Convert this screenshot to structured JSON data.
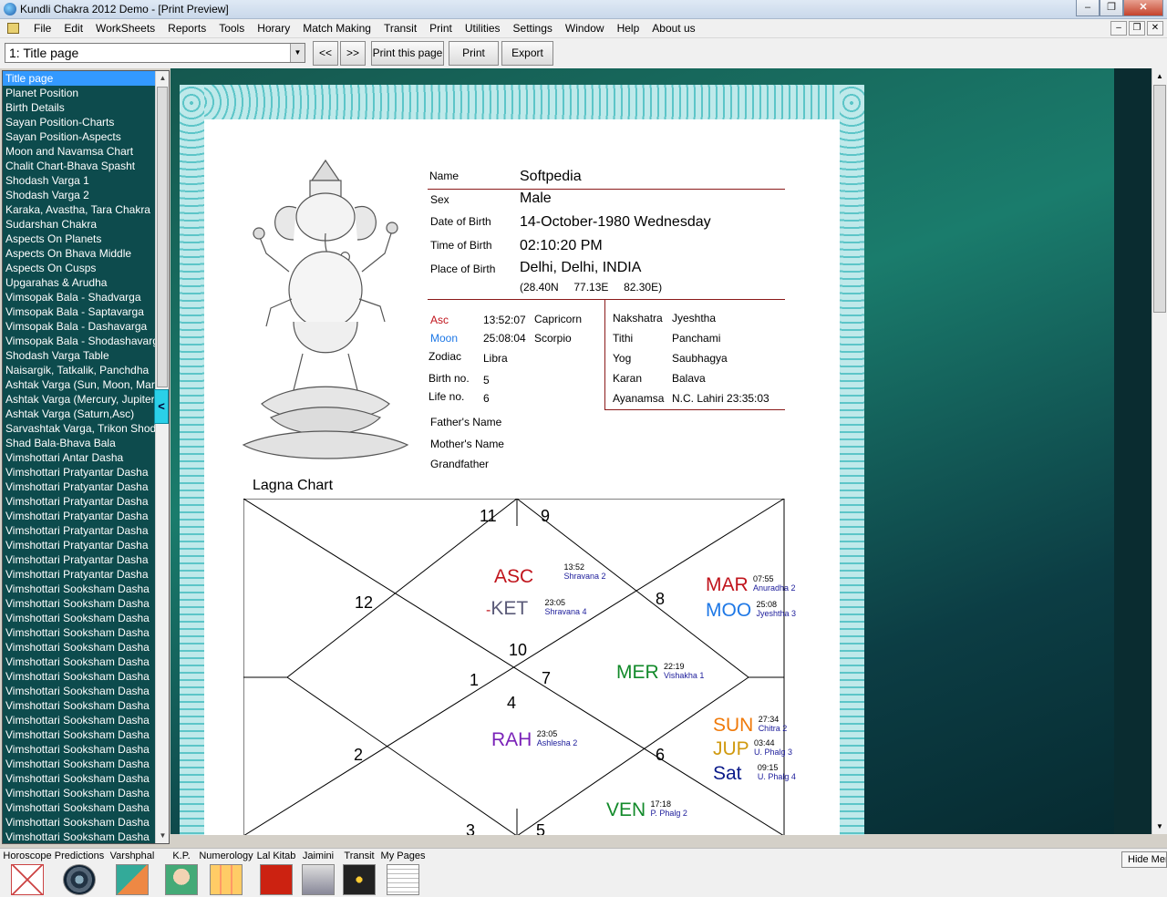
{
  "window": {
    "title": "Kundli Chakra 2012 Demo - [Print Preview]"
  },
  "menu": [
    "File",
    "Edit",
    "WorkSheets",
    "Reports",
    "Tools",
    "Horary",
    "Match Making",
    "Transit",
    "Print",
    "Utilities",
    "Settings",
    "Window",
    "Help",
    "About us"
  ],
  "toolbar": {
    "page_select": "1: Title page",
    "prev_label": "<<",
    "next_label": ">>",
    "print_page_label": "Print this page",
    "print_label": "Print",
    "export_label": "Export"
  },
  "sidebar": {
    "selected_index": 0,
    "items": [
      "Title page",
      "Planet Position",
      "Birth Details",
      "Sayan Position-Charts",
      "Sayan Position-Aspects",
      "Moon and Navamsa Chart",
      "Chalit Chart-Bhava Spasht",
      "Shodash Varga 1",
      "Shodash Varga 2",
      "Karaka, Avastha, Tara Chakra",
      "Sudarshan Chakra",
      "Aspects On Planets",
      "Aspects On Bhava Middle",
      "Aspects On Cusps",
      "Upgarahas & Arudha",
      "Vimsopak Bala - Shadvarga",
      "Vimsopak Bala - Saptavarga",
      "Vimsopak Bala - Dashavarga",
      "Vimsopak Bala - Shodashavarga",
      "Shodash Varga Table",
      "Naisargik, Tatkalik, Panchdha",
      "Ashtak Varga (Sun, Moon, Mars)",
      "Ashtak Varga (Mercury, Jupiter)",
      "Ashtak Varga (Saturn,Asc)",
      "Sarvashtak Varga, Trikon Shodhan",
      "Shad Bala-Bhava Bala",
      "Vimshottari Antar Dasha",
      "Vimshottari Pratyantar Dasha",
      "Vimshottari Pratyantar Dasha",
      "Vimshottari Pratyantar Dasha",
      "Vimshottari Pratyantar Dasha",
      "Vimshottari Pratyantar Dasha",
      "Vimshottari Pratyantar Dasha",
      "Vimshottari Pratyantar Dasha",
      "Vimshottari Pratyantar Dasha",
      "Vimshottari Sooksham Dasha",
      "Vimshottari Sooksham Dasha",
      "Vimshottari Sooksham Dasha",
      "Vimshottari Sooksham Dasha",
      "Vimshottari Sooksham Dasha",
      "Vimshottari Sooksham Dasha",
      "Vimshottari Sooksham Dasha",
      "Vimshottari Sooksham Dasha",
      "Vimshottari Sooksham Dasha",
      "Vimshottari Sooksham Dasha",
      "Vimshottari Sooksham Dasha",
      "Vimshottari Sooksham Dasha",
      "Vimshottari Sooksham Dasha",
      "Vimshottari Sooksham Dasha",
      "Vimshottari Sooksham Dasha",
      "Vimshottari Sooksham Dasha",
      "Vimshottari Sooksham Dasha",
      "Vimshottari Sooksham Dasha"
    ],
    "collapse_label": "<"
  },
  "details": {
    "name_label": "Name",
    "name": "Softpedia",
    "sex_label": "Sex",
    "sex": "Male",
    "dob_label": "Date of Birth",
    "dob": "14-October-1980 Wednesday",
    "tob_label": "Time of Birth",
    "tob": "02:10:20 PM",
    "pob_label": "Place of Birth",
    "pob": "Delhi, Delhi, INDIA",
    "coords": "(28.40N     77.13E     82.30E)",
    "asc_label": "Asc",
    "asc_time": "13:52:07",
    "asc_sign": "Capricorn",
    "moon_label": "Moon",
    "moon_time": "25:08:04",
    "moon_sign": "Scorpio",
    "zodiac_label": "Zodiac",
    "zodiac": "Libra",
    "birthno_label": "Birth no.",
    "birthno": "5",
    "lifeno_label": "Life no.",
    "lifeno": "6",
    "nakshatra_label": "Nakshatra",
    "nakshatra": "Jyeshtha",
    "tithi_label": "Tithi",
    "tithi": "Panchami",
    "yog_label": "Yog",
    "yog": "Saubhagya",
    "karan_label": "Karan",
    "karan": "Balava",
    "ayanamsa_label": "Ayanamsa",
    "ayanamsa": "N.C. Lahiri 23:35:03",
    "father_label": "Father's Name",
    "mother_label": "Mother's Name",
    "grandfather_label": "Grandfather"
  },
  "lagna_chart": {
    "title": "Lagna Chart",
    "houses": {
      "h11": "11",
      "h9": "9",
      "h12": "12",
      "h8": "8",
      "h10": "10",
      "h1": "1",
      "h7": "7",
      "h4": "4",
      "h2": "2",
      "h6": "6",
      "h3": "3",
      "h5": "5"
    },
    "planets": {
      "asc": {
        "abbr": "ASC",
        "time": "13:52",
        "nak": "Shravana 2",
        "color": "#c0141c"
      },
      "ket": {
        "abbr": "KET",
        "prefix": "-",
        "time": "23:05",
        "nak": "Shravana 4",
        "color": "#5a5a78"
      },
      "mar": {
        "abbr": "MAR",
        "time": "07:55",
        "nak": "Anuradha 2",
        "color": "#c0141c"
      },
      "moo": {
        "abbr": "MOO",
        "time": "25:08",
        "nak": "Jyeshtha 3",
        "color": "#1e78e6"
      },
      "mer": {
        "abbr": "MER",
        "time": "22:19",
        "nak": "Vishakha 1",
        "color": "#128a2a"
      },
      "rah": {
        "abbr": "RAH",
        "time": "23:05",
        "nak": "Ashlesha 2",
        "color": "#7a22b8"
      },
      "sun": {
        "abbr": "SUN",
        "time": "27:34",
        "nak": "Chitra 2",
        "color": "#f07a0a"
      },
      "jup": {
        "abbr": "JUP",
        "time": "03:44",
        "nak": "U. Phalg 3",
        "color": "#d09a10"
      },
      "sat": {
        "abbr": "Sat",
        "time": "09:15",
        "nak": "U. Phalg 4",
        "color": "#0a1a8a"
      },
      "ven": {
        "abbr": "VEN",
        "time": "17:18",
        "nak": "P. Phalg 2",
        "color": "#128a2a"
      }
    }
  },
  "bottom_bar": {
    "items": [
      "Horoscope",
      "Predictions",
      "Varshphal",
      "K.P.",
      "Numerology",
      "Lal Kitab",
      "Jaimini",
      "Transit",
      "My Pages"
    ],
    "hide_label": "Hide Menu"
  }
}
